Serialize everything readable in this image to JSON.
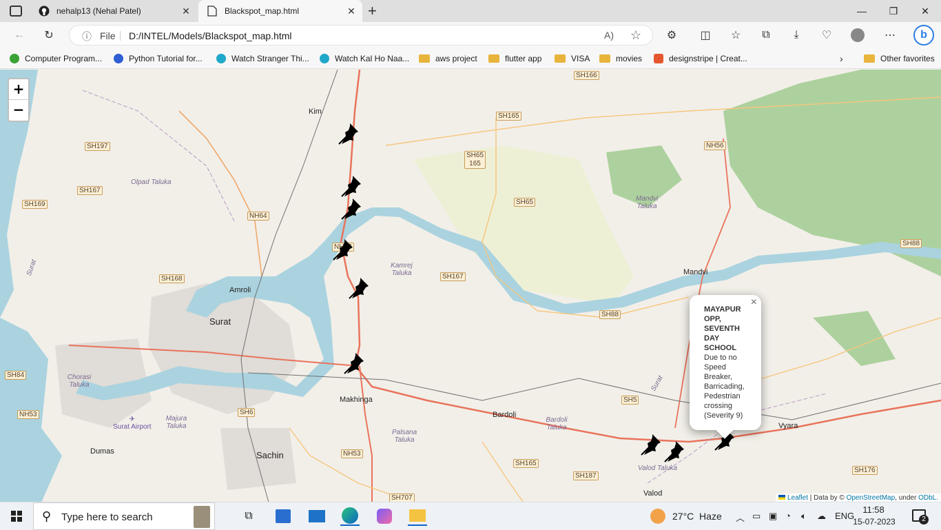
{
  "browser": {
    "tabs": [
      {
        "title": "nehalp13 (Nehal Patel)",
        "icon": "github-icon"
      },
      {
        "title": "Blackspot_map.html",
        "icon": "file-icon"
      }
    ],
    "new_tab_icon": "plus-icon",
    "address": {
      "scheme_label": "File",
      "url": "D:/INTEL/Models/Blackspot_map.html"
    },
    "favorites": [
      {
        "label": "Computer Program...",
        "icon": "green-circle-icon"
      },
      {
        "label": "Python Tutorial for...",
        "icon": "python-icon"
      },
      {
        "label": "Watch Stranger Thi...",
        "icon": "play-icon"
      },
      {
        "label": "Watch Kal Ho Naa...",
        "icon": "play-icon"
      },
      {
        "label": "aws project",
        "icon": "folder-icon"
      },
      {
        "label": "flutter app",
        "icon": "folder-icon"
      },
      {
        "label": "VISA",
        "icon": "folder-icon"
      },
      {
        "label": "movies",
        "icon": "folder-icon"
      },
      {
        "label": "designstripe | Creat...",
        "icon": "designstripe-icon"
      }
    ],
    "other_favorites": "Other favorites"
  },
  "map": {
    "zoom_in": "+",
    "zoom_out": "−",
    "cities": {
      "surat": "Surat",
      "sachin": "Sachin"
    },
    "towns": {
      "kim": "Kim",
      "amroli": "Amroli",
      "makhinga": "Makhinga",
      "bardoli": "Bardoli",
      "mandvi": "Mandvi",
      "vyara": "Vyara",
      "valod": "Valod",
      "dumas": "Dumas",
      "surat_airport": "Surat Airport"
    },
    "talukas": {
      "olpad": "Olpad Taluka",
      "kamrej": "Kamrej Taluka",
      "mandvi": "Mandvi Taluka",
      "chorasi": "Chorasi Taluka",
      "majura": "Majura Taluka",
      "palsana": "Palsana Taluka",
      "bardoli": "Bardoli Taluka",
      "valod": "Valod Taluka"
    },
    "roads": [
      "SH166",
      "SH165",
      "SH65",
      "165",
      "SH197",
      "SH167",
      "SH169",
      "NH64",
      "NH56",
      "SH65",
      "SH168",
      "NH48",
      "SH167",
      "SH88",
      "SH88",
      "SH84",
      "NH53",
      "SH6",
      "NH53",
      "SH165",
      "SH187",
      "SH5",
      "SH176",
      "SH707"
    ],
    "river_labels": {
      "surat_left": "Surat",
      "surat_right": "Surat"
    },
    "popup": {
      "title": "MAYAPUR OPP, SEVENTH DAY SCHOOL",
      "description": "Due to no Speed Breaker, Barricading, Pedestrian crossing (Severity 9)",
      "close": "×"
    },
    "attribution": {
      "leaflet": "Leaflet",
      "data_by": "| Data by ©",
      "osm": "OpenStreetMap",
      "under": ", under",
      "odbl": "ODbL."
    }
  },
  "taskbar": {
    "search_placeholder": "Type here to search",
    "weather": "27°C  Haze",
    "language": "ENG",
    "time": "11:58",
    "date": "15-07-2023",
    "notifications": "2"
  }
}
